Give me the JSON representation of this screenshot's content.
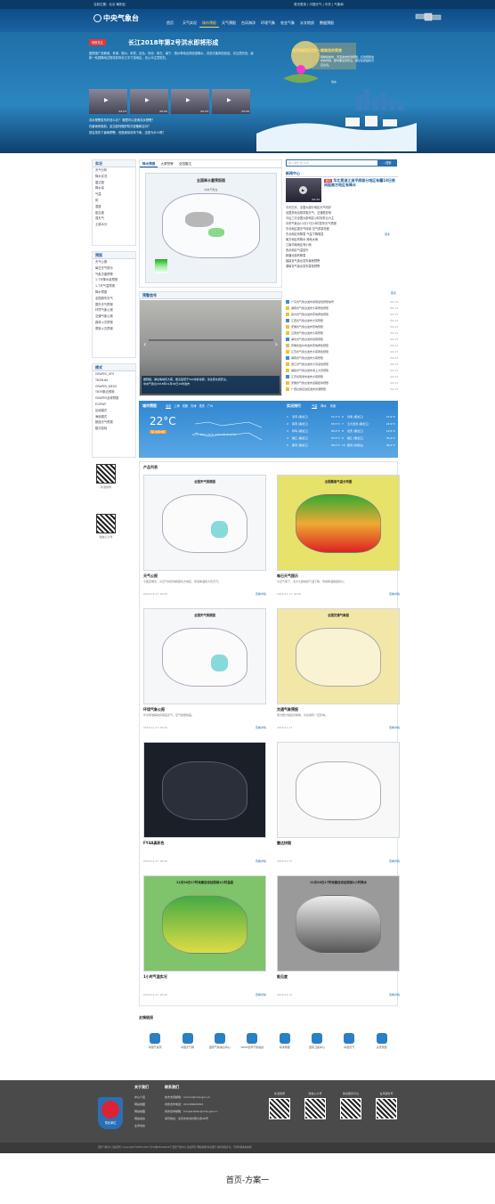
{
  "topbar": {
    "location": "当前位置：北京 朝阳区",
    "links": "首页登录 | 中国天气 | 中央 | 气象局"
  },
  "header": {
    "logo": "中央气象台",
    "nav": [
      "首页",
      "天气实况",
      "城市预报",
      "天气预报",
      "台风海洋",
      "环境气象",
      "农业气象",
      "水文地质",
      "数据预报"
    ],
    "active": 2
  },
  "hero": {
    "badge": "特别关注",
    "headline": "长江2018年第2号洪水即将形成",
    "body": "据预报广西柳城、贵港、梧州、来宾、百色、河池、崇左、南宁、梧州等地出现较强降水，洪涝灾害风险较高，请注意防范。最新一轮强降雨过程将影响长江中下游地区，请公众注意防范。",
    "thumbs": [
      {
        "time": "04:23"
      },
      {
        "time": "00:00"
      },
      {
        "time": "00:43"
      },
      {
        "time": "00:06"
      }
    ],
    "questions": [
      "洪水预警发布时怎么办？ 哪里可以查询洪水预警？",
      "在暴雨来临前，应当如何做好防汛准备和应对？",
      "是否发布了暴雨预警，但是我却没有下雨，这是为什么呢？"
    ],
    "banner": "在河流附近过往一楼路径的家房",
    "illustration_text": "雨季经常时，河流发布防洪预警，红色预警发布的时候，那时要注意安全。要记住家庭防汛应急包。",
    "illustration_caption": "洪水"
  },
  "left": {
    "s1": {
      "title": "实况",
      "items": [
        "天气分析",
        "降水实况",
        "雷达图",
        "降水量",
        "气温",
        "风",
        "湿度",
        "能见度",
        "强天气",
        "土壤水分"
      ]
    },
    "s2": {
      "title": "预报",
      "items": [
        "天气公报",
        "每日天气提示",
        "气象灾害预警",
        "1-7天降水量预报",
        "1-7天气温预报",
        "降水预报",
        "全国城市天气",
        "国外天气预报",
        "环境气象公报",
        "交通气象公报",
        "森林火灾预报",
        "草原火灾预报"
      ]
    },
    "s3": {
      "title": "模式",
      "items": [
        "GRAPES_GFS",
        "T639L60",
        "GRAPES_MESO",
        "T639集合预报",
        "GRAPES全球预报",
        "ECMWF",
        "区域模式",
        "海浪模式",
        "数值天气预报",
        "模式检验"
      ]
    },
    "qr1": "新浪微博",
    "qr2": "微信公众号"
  },
  "warn": {
    "tabs": [
      "降水预报",
      "大雾预警",
      "全国雷达"
    ],
    "map_title": "全国降水量预报图",
    "map_sub": "中央气象台",
    "signal_title": "预警信号",
    "photo_caption": "据预报，湖北等地有大雾，能见度低于500米的浓雾，请注意交通安全。",
    "photo_meta": "中央气象台2018年11月26日10时发布"
  },
  "news": {
    "search_placeholder": "输入城市 如 北京",
    "search_btn": "搜索",
    "title": "新闻中心",
    "video_time": "00:43",
    "feature_badge": "要闻",
    "feature": "华北黄淮江淮平原部分地区有霾18日夜间起南方地区有降水",
    "items": [
      "今天白天，全国大部分地区天气晴好",
      "全国多地出现雾霾天气，交通受影响",
      "今后三天全国大部地区以晴到多云为主",
      "中央气象台11月17日18时发布天气预报",
      "华北地区霾天气持续 空气质量较差",
      "东北地区有降雪 气温下降明显",
      "南方地区有降水 局地大雨",
      "江南华南地区有小雨",
      "西北地区气温回升",
      "新疆北部有降雪",
      "福建省气象台发布暴雨预警",
      "湖南省气象台发布雷电预警"
    ],
    "more": "更多"
  },
  "signals": {
    "more": "更多",
    "items": [
      "广东省气象台发布暴雨蓝色预警信号",
      "湖南省气象台发布大雾黄色预警",
      "贵州省气象台发布雷电黄色预警",
      "江西省气象台发布大风预警",
      "安徽省气象台发布雷电预警",
      "云南省气象台发布大雾预警",
      "湖北省气象台发布暴雨预警",
      "安徽省宿州市发布雷电黄色预警",
      "江苏省气象台发布大雾黄色预警",
      "湖南省气象台发布大雾预警",
      "浙江省气象台发布大风蓝色预警",
      "福建省气象台发布海上大风预警",
      "江苏省南通市发布大雾预警",
      "安徽省气象台发布道路结冰预警",
      "广西壮族自治区发布寒潮预警"
    ],
    "dates": [
      "09-13",
      "09-13",
      "09-13",
      "09-13",
      "09-13",
      "09-13",
      "09-13",
      "09-13",
      "09-13",
      "09-13",
      "09-13",
      "09-13",
      "09-13",
      "09-13",
      "09-13"
    ]
  },
  "city": {
    "title": "城市预报",
    "tabs": [
      "北京",
      "上海",
      "成都",
      "天津",
      "重庆",
      "广州"
    ],
    "temp": "22°C",
    "desc": "晴 北风3级",
    "range": "22°C  19°C  22°C  22°C  23°C  17°C",
    "rank_title": "实况排行",
    "rank_tabs": [
      "气温",
      "降水",
      "风速"
    ],
    "rank_left": [
      [
        "1",
        "漠河 (黑龙江)",
        "31.4°C"
      ],
      [
        "2",
        "塔河 (黑龙江)",
        "33.5°C"
      ],
      [
        "3",
        "呼玛 (黑龙江)",
        "35.4°C"
      ],
      [
        "4",
        "嫩江 (黑龙江)",
        "33.5°C"
      ],
      [
        "5",
        "黑河 (黑龙江)",
        "36.5°C"
      ]
    ],
    "rank_right": [
      [
        "6",
        "孙吴 (黑龙江)",
        "15.4°C"
      ],
      [
        "7",
        "五大连池 (黑龙江)",
        "22.9°C"
      ],
      [
        "8",
        "北安 (黑龙江)",
        "19.5°C"
      ],
      [
        "9",
        "嫩江 (黑龙江)",
        "35.4°C"
      ],
      [
        "10",
        "根河 (内蒙古)",
        "36.5°C"
      ]
    ]
  },
  "products": {
    "title": "产品列表",
    "items": [
      {
        "title": "天气公报",
        "desc": "今夜至明天，冷空气将影响我国北方地区，带来降温和大风天气。",
        "date": "2018-11-17 18:00",
        "more": "查看详情",
        "map_title": "全国天气预报图"
      },
      {
        "title": "每日天气提示",
        "desc": "冷空气南下，北方大部地区气温下降，局地降温幅度较大。",
        "date": "2018-11-17 18:00",
        "more": "查看详情",
        "map_title": "全国最高气温分布图"
      },
      {
        "title": "环境气象公报",
        "desc": "华北黄淮等地有雾霾天气，空气质量较差。",
        "date": "2018-11-17 18:00",
        "more": "查看详情",
        "map_title": "全国天气预报图"
      },
      {
        "title": "交通气象预报",
        "desc": "南方部分地区有降雨，对交通有一定影响。",
        "date": "2018-11-17",
        "more": "查看详情",
        "map_title": "全国交通气象图"
      },
      {
        "title": "FY4A真彩色",
        "desc": "",
        "date": "2018-11-17 18:00",
        "more": "查看详情",
        "map_title": ""
      },
      {
        "title": "雷达拼图",
        "desc": "",
        "date": "2018-11-17",
        "more": "查看详情",
        "map_title": ""
      },
      {
        "title": "1小时气温实况",
        "desc": "",
        "date": "2018-11-17 18:00",
        "more": "查看详情",
        "map_title": "11月26日17时地面自动站观测1小时温度"
      },
      {
        "title": "能见度",
        "desc": "",
        "date": "2018-11-17",
        "more": "查看详情",
        "map_title": "11月26日17时地面自动站观测1小时降水"
      }
    ]
  },
  "links": {
    "title": "友情链接",
    "items": [
      "中国气象局",
      "中国天气网",
      "国家气象信息中心",
      "WMO世界气象组织",
      "海洋预报",
      "国家卫星中心",
      "中国天气",
      "灾害预警"
    ]
  },
  "footer": {
    "about_title": "关于我们",
    "contact_title": "联系我们",
    "about": [
      "中心介绍",
      "网站地图",
      "网站地图",
      "网站动态",
      "业务动态"
    ],
    "contact": [
      "技术支持邮箱：nmccn@cma.gov.cn",
      "商务合作电话：010-68400393",
      "商务合作邮箱：Cooperation@cma.gov.cn",
      "通讯地址：北京市中关村南大街46号"
    ],
    "qrs": [
      "新浪微博",
      "微信公众号",
      "移动服务平台",
      "台风服务号"
    ],
    "emblem": "事业单位",
    "copyright": "国家气象中心  版权所有  Copyright©2008-2018  京ICP备05004624号  国家气象中心  版权所有  网站地图  联系我们  未经书面许可，不得转载本站内容"
  },
  "caption": "首页-方案一"
}
